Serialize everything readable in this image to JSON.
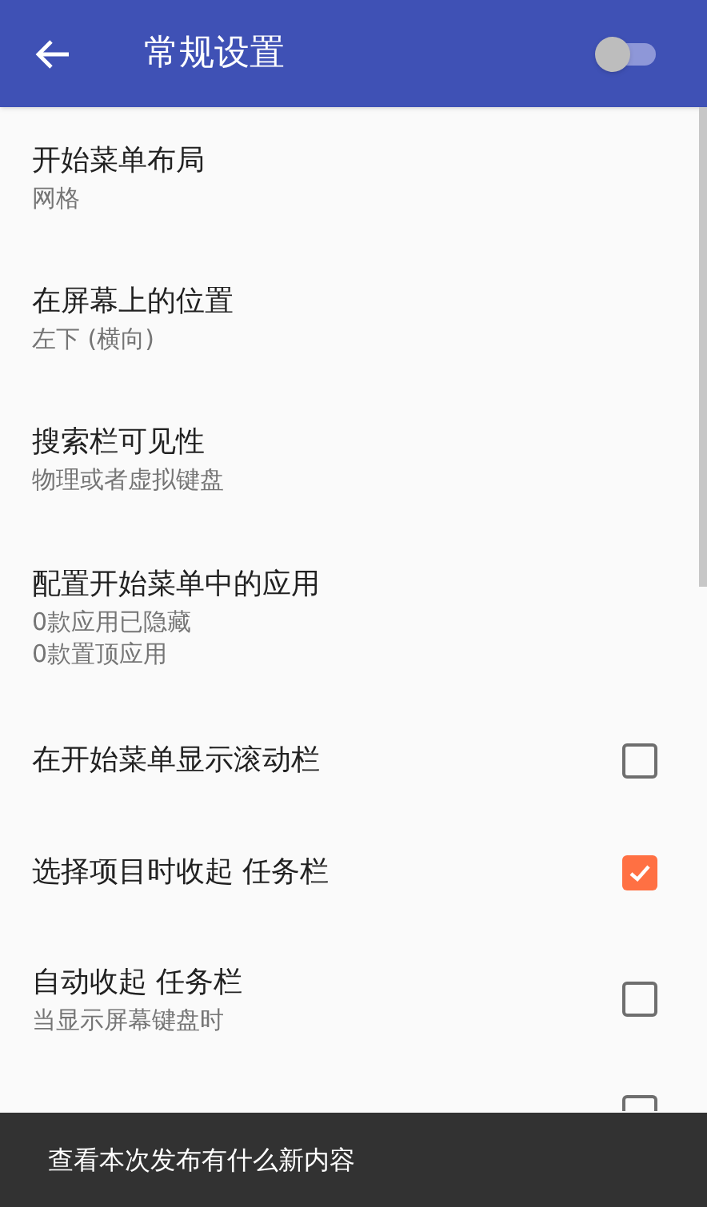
{
  "app_bar": {
    "title": "常规设置",
    "master_switch": {
      "on": false
    }
  },
  "settings": [
    {
      "kind": "text",
      "title": "开始菜单布局",
      "summary": [
        "网格"
      ]
    },
    {
      "kind": "text",
      "title": "在屏幕上的位置",
      "summary": [
        "左下 (横向)"
      ]
    },
    {
      "kind": "text",
      "title": "搜索栏可见性",
      "summary": [
        "物理或者虚拟键盘"
      ]
    },
    {
      "kind": "text",
      "title": "配置开始菜单中的应用",
      "summary": [
        "0款应用已隐藏",
        "0款置顶应用"
      ]
    },
    {
      "kind": "checkbox",
      "title": "在开始菜单显示滚动栏",
      "checked": false
    },
    {
      "kind": "checkbox",
      "title": "选择项目时收起 任务栏",
      "checked": true
    },
    {
      "kind": "checkbox",
      "title": "自动收起 任务栏",
      "summary": [
        "当显示屏幕键盘时"
      ],
      "checked": false
    },
    {
      "kind": "covered_checkbox",
      "checked": false
    }
  ],
  "snackbar": {
    "message": "查看本次发布有什么新内容"
  }
}
